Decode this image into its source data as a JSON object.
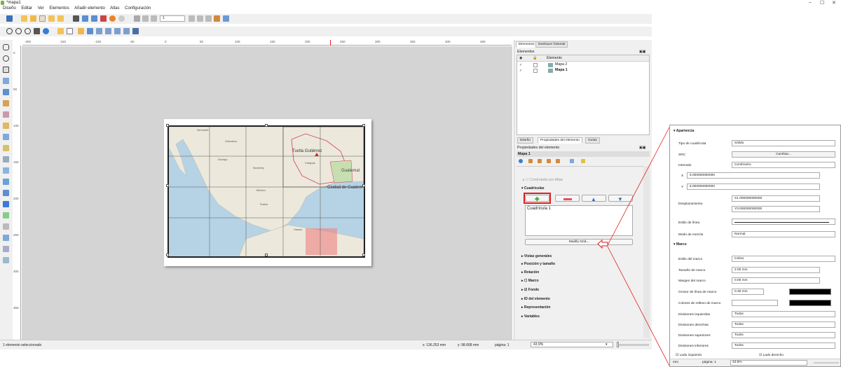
{
  "window": {
    "title": "*mapa1",
    "minimize": "–",
    "restore": "☐",
    "close": "✕"
  },
  "menu": [
    "Diseño",
    "Editar",
    "Ver",
    "Elementos",
    "Añadir elemento",
    "Atlas",
    "Configuración"
  ],
  "toolbar": {
    "page_field": "1"
  },
  "ruler_h": [
    "-200",
    "-150",
    "-100",
    "-50",
    "0",
    "50",
    "100",
    "150",
    "200",
    "250",
    "300",
    "350",
    "400",
    "450"
  ],
  "ruler_v": [
    "0",
    "50",
    "100",
    "150",
    "200",
    "250",
    "300",
    "350"
  ],
  "map_labels": [
    "Tuxtla Gutiérrez",
    "Chiapas",
    "Guatemal",
    "Ciudad de Guatem",
    "México",
    "Hermosillo",
    "Monterrey",
    "Chihuahua",
    "Durango",
    "Puebla",
    "Oaxaca"
  ],
  "panel": {
    "tabs_top": [
      "Elementos",
      "Deshacer historial"
    ],
    "items_header": "Elementos",
    "col_element": "Elemento",
    "items": [
      "Mapa 2",
      "Mapa 1"
    ],
    "tabs_bottom": [
      "Diseño",
      "Propiedades del elemento",
      "Guías"
    ],
    "props_title": "Propiedades del elemento",
    "map_name": "Mapa 1",
    "controlled_atlas": "Controlado por Atlas",
    "grids_section": "Cuadrículas",
    "grid_item": "Cuadrícula 1",
    "modify_grid": "Modify Grid...",
    "sections": [
      "Vistas generales",
      "Posición y tamaño",
      "Rotación",
      "Marco",
      "Fondo",
      "ID del elemento",
      "Representación",
      "Variables"
    ]
  },
  "status": {
    "selected": "1 elemento seleccionado",
    "x": "x: 136.253 mm",
    "y": "y: 98.668 mm",
    "page": "página: 1",
    "zoom": "43.9%"
  },
  "popup": {
    "apariencia": "Apariencia",
    "tipo_label": "Tipo de cuadrícula",
    "tipo_val": "Sólido",
    "src_label": "SRC",
    "src_btn": "Cambiar...",
    "intervalo_label": "Intervalo",
    "intervalo_val": "Centímetro",
    "x_label": "X",
    "x_val": "5.000000000000",
    "y_label": "Y",
    "y_val": "5.000000000000",
    "desp_label": "Desplazamiento",
    "desp_x": "X1.000000000000",
    "desp_y": "Y0.000000000000",
    "estilo_label": "Estilo de línea",
    "modo_label": "Modo de mezcla",
    "modo_val": "Normal",
    "marco": "Marco",
    "estilo_marco_label": "Estilo del marco",
    "estilo_marco_val": "Cebra",
    "tam_label": "Tamaño de marco",
    "tam_val": "2.00 mm",
    "margen_label": "Margen del marco",
    "margen_val": "0.00 mm",
    "grosor_label": "Grosor de línea de marco",
    "grosor_val": "0.30 mm",
    "relleno_label": "Colores de relleno de marco",
    "div_izq_label": "Divisiones izquierdas",
    "div_izq_val": "Todos",
    "div_der_label": "Divisiones derechas",
    "div_der_val": "Todos",
    "div_sup_label": "Divisiones superiores",
    "div_sup_val": "Todos",
    "div_inf_label": "Divisiones inferiores",
    "div_inf_val": "Todos",
    "lado_izq": "Lado izquierdo",
    "lado_der": "Lado derecho",
    "status_unit": "mm",
    "status_page": "página: 1",
    "status_zoom": "43.9%"
  },
  "colors": {
    "accent_red": "#e02020",
    "toolbar_bg": "#f0f0f0",
    "water": "#b6d3e5",
    "land": "#ece8dc"
  }
}
